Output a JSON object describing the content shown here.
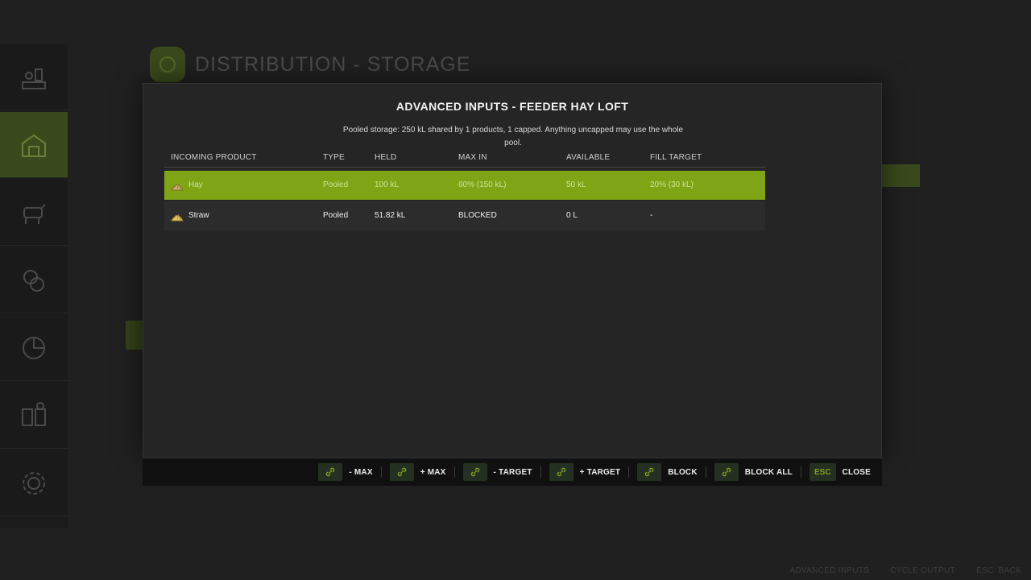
{
  "background": {
    "title": "DISTRIBUTION - STORAGE",
    "sidebar_icons": [
      "production-icon",
      "storage-barn-icon",
      "animals-icon",
      "finances-icon",
      "statistics-icon",
      "help-book-icon",
      "settings-gear-icon"
    ],
    "footer": [
      {
        "key": "",
        "label": "ADVANCED INPUTS"
      },
      {
        "key": "",
        "label": "CYCLE OUTPUT"
      },
      {
        "key": "ESC",
        "label": "BACK"
      }
    ]
  },
  "modal": {
    "title": "ADVANCED INPUTS - FEEDER HAY LOFT",
    "description": "Pooled storage: 250 kL shared by 1 products, 1 capped. Anything uncapped may use the whole pool.",
    "columns": {
      "product": "INCOMING PRODUCT",
      "type": "TYPE",
      "held": "HELD",
      "max_in": "MAX IN",
      "available": "AVAILABLE",
      "fill_target": "FILL TARGET"
    },
    "rows": [
      {
        "product": "Hay",
        "type": "Pooled",
        "held": "100 kL",
        "max_in": "60%  (150 kL)",
        "available": "50 kL",
        "fill_target": "20%  (30 kL)",
        "selected": true,
        "icon": "hay-pile-icon"
      },
      {
        "product": "Straw",
        "type": "Pooled",
        "held": "51.82 kL",
        "max_in": "BLOCKED",
        "available": "0 L",
        "fill_target": "-",
        "selected": false,
        "icon": "straw-pile-icon"
      }
    ]
  },
  "actions": [
    {
      "key": "link-icon",
      "label": "- MAX"
    },
    {
      "key": "link-icon",
      "label": "+ MAX"
    },
    {
      "key": "link-icon",
      "label": "- TARGET"
    },
    {
      "key": "link-icon",
      "label": "+ TARGET"
    },
    {
      "key": "link-icon",
      "label": "BLOCK"
    },
    {
      "key": "link-icon",
      "label": "BLOCK ALL"
    },
    {
      "key": "ESC",
      "label": "CLOSE"
    }
  ],
  "colors": {
    "accent": "#7fa416",
    "panel": "#252525",
    "row": "#2c2c2c"
  }
}
